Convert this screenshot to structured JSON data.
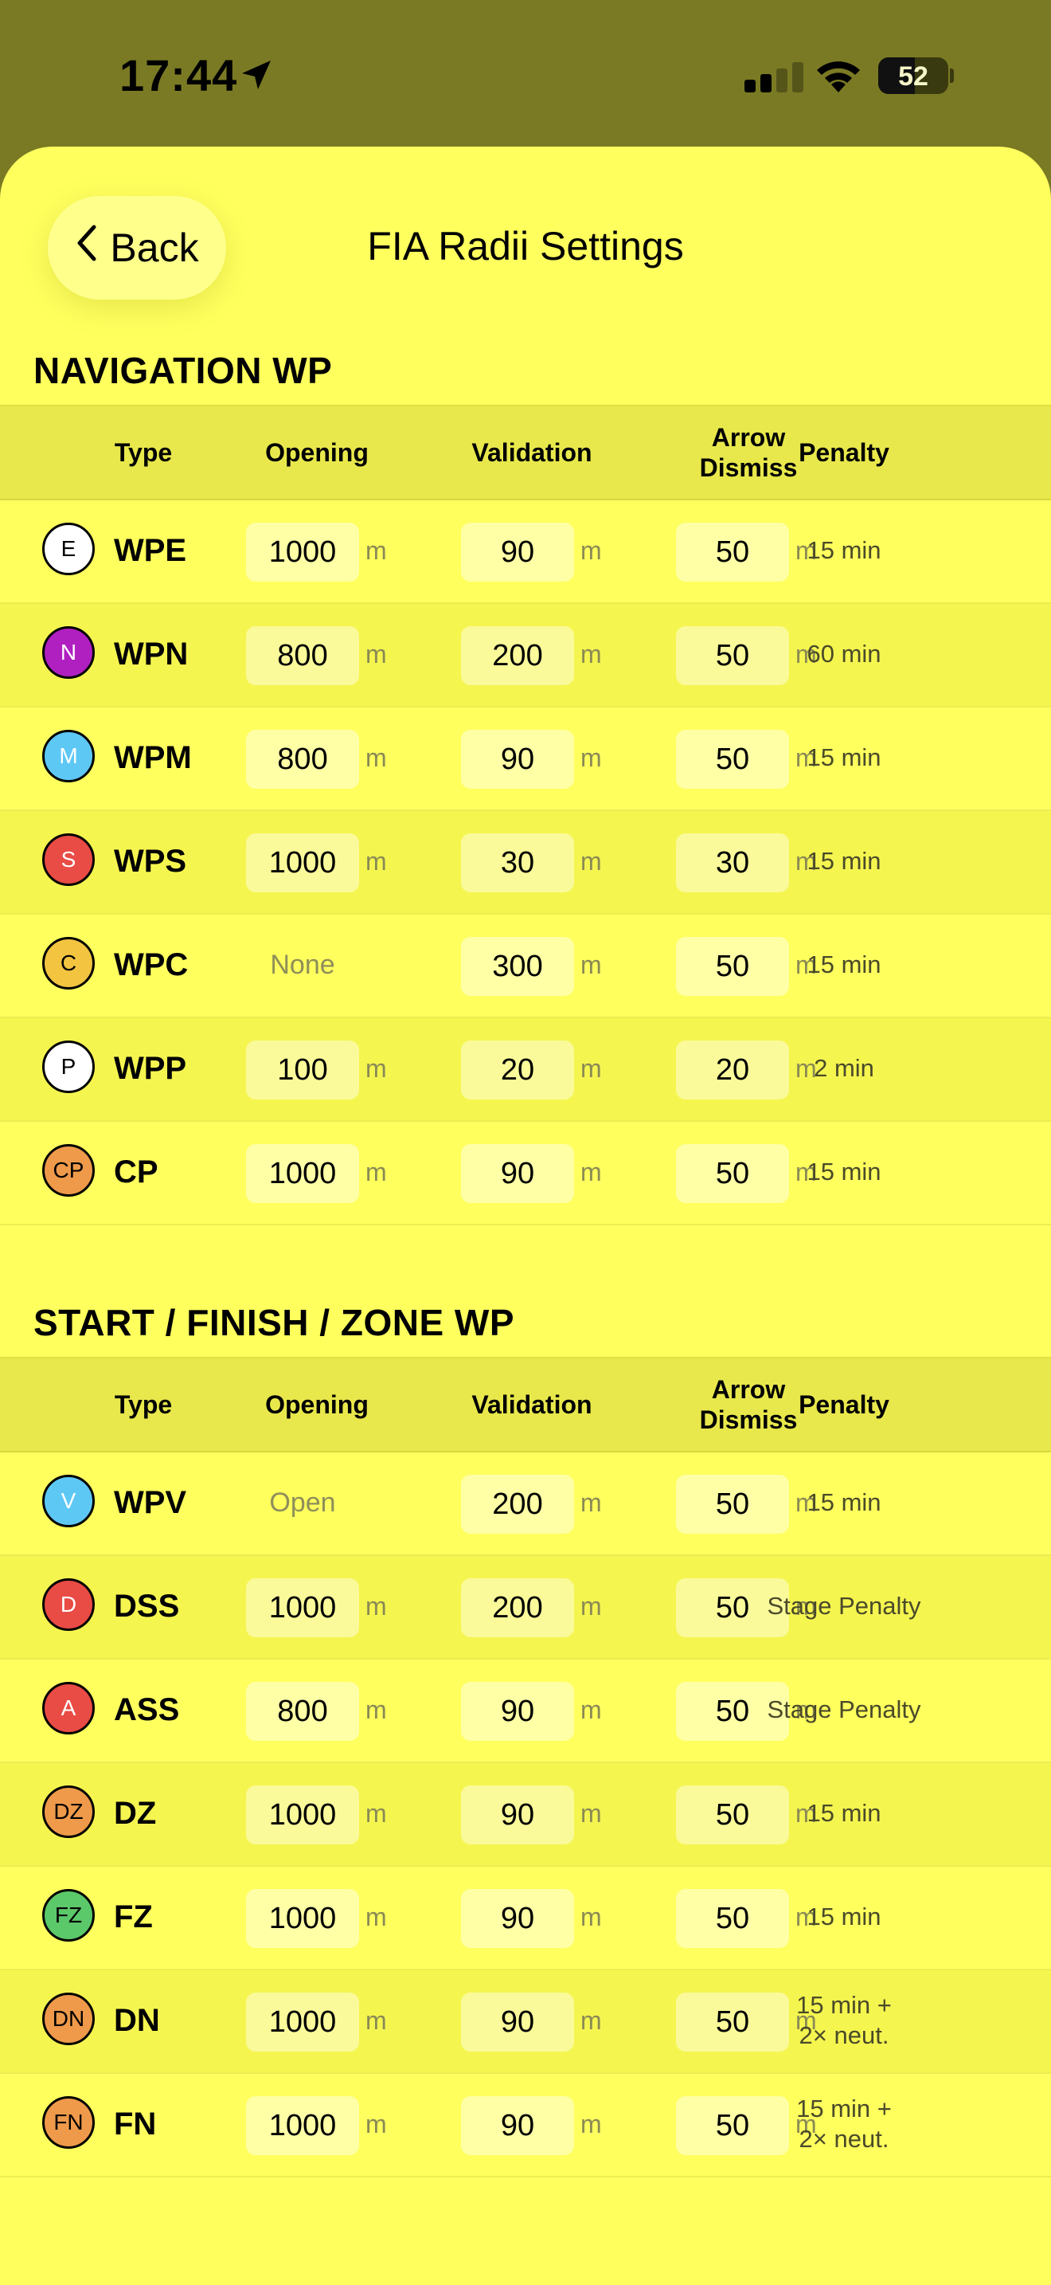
{
  "status": {
    "time": "17:44",
    "battery": "52",
    "battery_level": 0.52
  },
  "header": {
    "back_label": "Back",
    "title": "FIA Radii Settings"
  },
  "columns": {
    "type": "Type",
    "opening": "Opening",
    "validation": "Validation",
    "arrow_dismiss": "Arrow Dismiss",
    "penalty": "Penalty"
  },
  "unit": "m",
  "colors": {
    "sheet": "#ffff5e",
    "header_row": "#e8e84c",
    "status_bar": "#7a7a24"
  },
  "sections": [
    {
      "title": "NAVIGATION WP",
      "rows": [
        {
          "badge": "E",
          "badge_color": "#ffffff",
          "badge_text_color": "#000000",
          "type": "WPE",
          "opening": "1000",
          "opening_is_field": true,
          "validation": "90",
          "arrow": "50",
          "penalty": "15 min"
        },
        {
          "badge": "N",
          "badge_color": "#b01fc0",
          "badge_text_color": "#ffffff",
          "type": "WPN",
          "opening": "800",
          "opening_is_field": true,
          "validation": "200",
          "arrow": "50",
          "penalty": "60 min"
        },
        {
          "badge": "M",
          "badge_color": "#5ec8f5",
          "badge_text_color": "#ffffff",
          "type": "WPM",
          "opening": "800",
          "opening_is_field": true,
          "validation": "90",
          "arrow": "50",
          "penalty": "15 min"
        },
        {
          "badge": "S",
          "badge_color": "#e94b45",
          "badge_text_color": "#ffffff",
          "type": "WPS",
          "opening": "1000",
          "opening_is_field": true,
          "validation": "30",
          "arrow": "30",
          "penalty": "15 min"
        },
        {
          "badge": "C",
          "badge_color": "#f2c440",
          "badge_text_color": "#000000",
          "type": "WPC",
          "opening": "None",
          "opening_is_field": false,
          "validation": "300",
          "arrow": "50",
          "penalty": "15 min"
        },
        {
          "badge": "P",
          "badge_color": "#ffffff",
          "badge_text_color": "#000000",
          "type": "WPP",
          "opening": "100",
          "opening_is_field": true,
          "validation": "20",
          "arrow": "20",
          "penalty": "2 min"
        },
        {
          "badge": "CP",
          "badge_color": "#ee9a4a",
          "badge_text_color": "#000000",
          "type": "CP",
          "opening": "1000",
          "opening_is_field": true,
          "validation": "90",
          "arrow": "50",
          "penalty": "15 min"
        }
      ]
    },
    {
      "title": "START / FINISH / ZONE WP",
      "rows": [
        {
          "badge": "V",
          "badge_color": "#5ec8f5",
          "badge_text_color": "#ffffff",
          "type": "WPV",
          "opening": "Open",
          "opening_is_field": false,
          "validation": "200",
          "arrow": "50",
          "penalty": "15 min"
        },
        {
          "badge": "D",
          "badge_color": "#e94b45",
          "badge_text_color": "#ffffff",
          "type": "DSS",
          "opening": "1000",
          "opening_is_field": true,
          "validation": "200",
          "arrow": "50",
          "penalty": "Stage Penalty"
        },
        {
          "badge": "A",
          "badge_color": "#e94b45",
          "badge_text_color": "#ffffff",
          "type": "ASS",
          "opening": "800",
          "opening_is_field": true,
          "validation": "90",
          "arrow": "50",
          "penalty": "Stage Penalty"
        },
        {
          "badge": "DZ",
          "badge_color": "#ee9a4a",
          "badge_text_color": "#000000",
          "type": "DZ",
          "opening": "1000",
          "opening_is_field": true,
          "validation": "90",
          "arrow": "50",
          "penalty": "15 min"
        },
        {
          "badge": "FZ",
          "badge_color": "#5bc86a",
          "badge_text_color": "#000000",
          "type": "FZ",
          "opening": "1000",
          "opening_is_field": true,
          "validation": "90",
          "arrow": "50",
          "penalty": "15 min"
        },
        {
          "badge": "DN",
          "badge_color": "#ee9a4a",
          "badge_text_color": "#000000",
          "type": "DN",
          "opening": "1000",
          "opening_is_field": true,
          "validation": "90",
          "arrow": "50",
          "penalty": "15 min +\n2× neut."
        },
        {
          "badge": "FN",
          "badge_color": "#ee9a4a",
          "badge_text_color": "#000000",
          "type": "FN",
          "opening": "1000",
          "opening_is_field": true,
          "validation": "90",
          "arrow": "50",
          "penalty": "15 min +\n2× neut."
        }
      ]
    }
  ]
}
